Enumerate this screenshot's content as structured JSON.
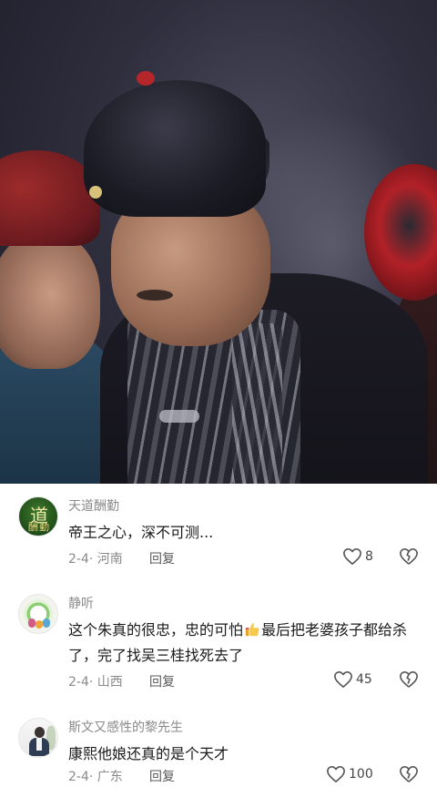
{
  "video": {
    "scene_icon": "drama-scene-still"
  },
  "comments": [
    {
      "username": "天道酬勤",
      "text": "帝王之心，深不可测...",
      "date": "2-4",
      "location": "河南",
      "reply_label": "回复",
      "likes": "8",
      "avatar_text": [
        "道",
        "酬勤"
      ]
    },
    {
      "username": "静听",
      "text_before_emoji": "这个朱真的很忠，忠的可怕",
      "emoji": "thumbs-up-emoji",
      "text_after_emoji": "最后把老婆孩子都给杀了，完了找吴三桂找死去了",
      "date": "2-4",
      "location": "山西",
      "reply_label": "回复",
      "likes": "45"
    },
    {
      "username": "斯文又感性的黎先生",
      "text": "康熙他娘还真的是个天才",
      "date": "2-4",
      "location": "广东",
      "reply_label": "回复",
      "likes": "100"
    }
  ],
  "colors": {
    "meta_gray": "#8a8a8a",
    "text": "#1a1a1a",
    "background": "#ffffff"
  }
}
